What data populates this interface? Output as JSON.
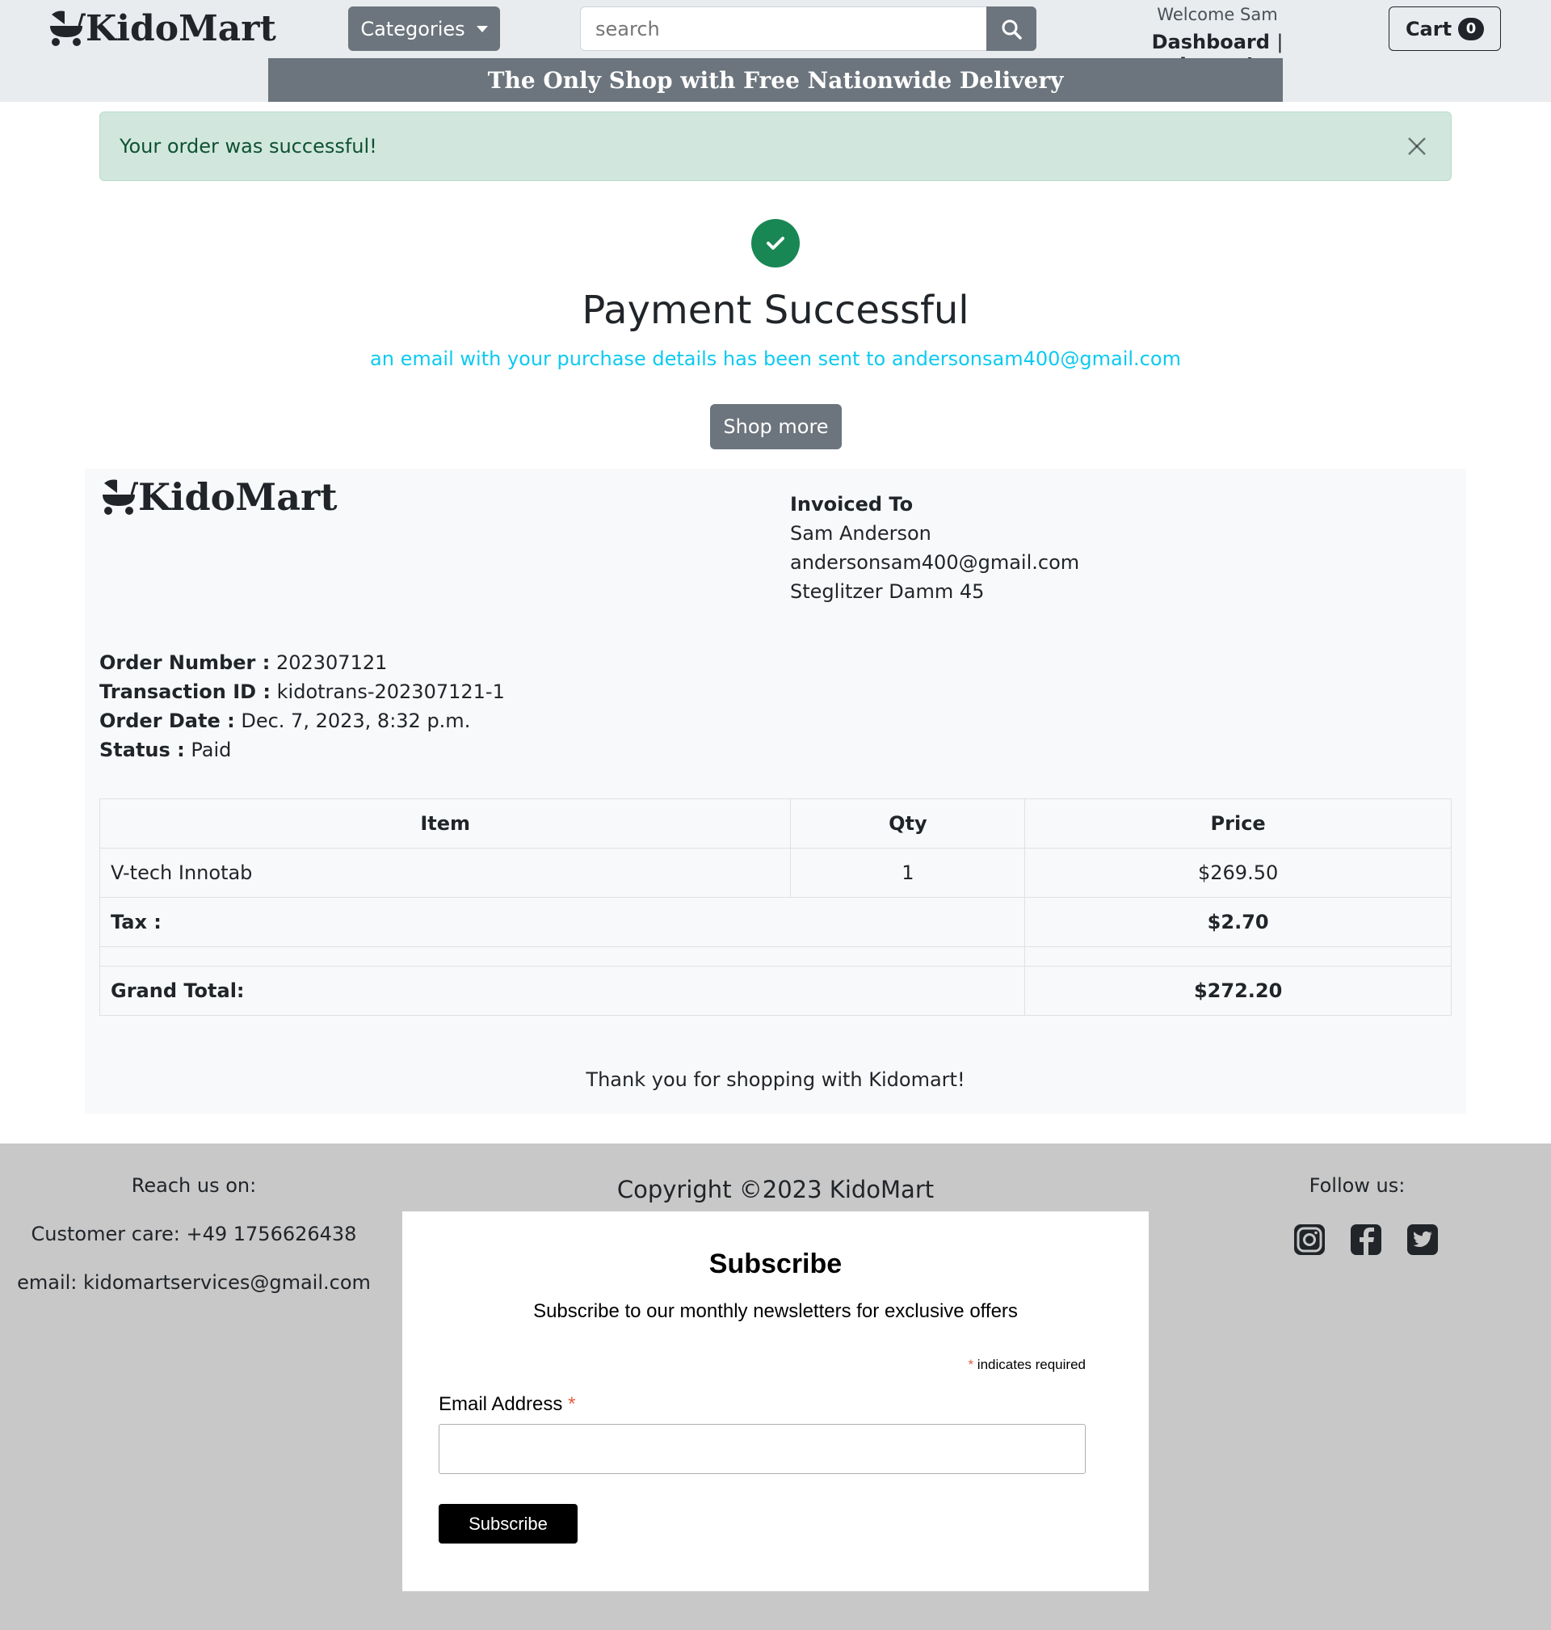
{
  "header": {
    "logo_text": "KidoMart",
    "categories_label": "Categories",
    "search": {
      "placeholder": "search",
      "value": ""
    },
    "welcome_text": "Welcome Sam",
    "dashboard_label": "Dashboard",
    "separator": "|",
    "logout_label": "Logout",
    "cart_label": "Cart",
    "cart_count": "0",
    "promo_text": "The Only Shop with Free Nationwide Delivery"
  },
  "alert": {
    "message": "Your order was successful!"
  },
  "success": {
    "title": "Payment Successful",
    "email_note": "an email with your purchase details has been sent to andersonsam400@gmail.com",
    "shop_more_label": "Shop more"
  },
  "invoice": {
    "logo_text": "KidoMart",
    "invoiced_to_label": "Invoiced To",
    "customer_name": "Sam Anderson",
    "customer_email": "andersonsam400@gmail.com",
    "customer_address": "Steglitzer Damm 45",
    "order_number_label": "Order Number :",
    "order_number": "202307121",
    "transaction_id_label": "Transaction ID :",
    "transaction_id": "kidotrans-202307121-1",
    "order_date_label": "Order Date :",
    "order_date": "Dec. 7, 2023, 8:32 p.m.",
    "status_label": "Status :",
    "status": "Paid",
    "table": {
      "headers": [
        "Item",
        "Qty",
        "Price"
      ],
      "rows": [
        {
          "item": "V-tech Innotab",
          "qty": "1",
          "price": "$269.50"
        }
      ],
      "tax_label": "Tax :",
      "tax_value": "$2.70",
      "grand_total_label": "Grand Total:",
      "grand_total_value": "$272.20"
    },
    "thanks": "Thank you for shopping with Kidomart!"
  },
  "footer": {
    "reach_label": "Reach us on:",
    "customer_care": "Customer care: +49 1756626438",
    "email_prefix": "email:",
    "email": "kidomartservices@gmail.com",
    "copyright": "Copyright ©2023 KidoMart",
    "follow_label": "Follow us:",
    "socials": [
      "instagram-icon",
      "facebook-icon",
      "twitter-icon"
    ],
    "subscribe": {
      "title": "Subscribe",
      "description": "Subscribe to our monthly newsletters for exclusive offers",
      "required_mark": "*",
      "required_note": "indicates required",
      "email_label": "Email Address",
      "email_value": "",
      "button_label": "Subscribe"
    }
  },
  "colors": {
    "header_bg": "#e9ecef",
    "secondary": "#6c757d",
    "alert_bg": "#d1e7dd",
    "alert_text": "#0f5132",
    "success_green": "#198754",
    "info_cyan": "#0dcaf0",
    "invoice_bg": "#f8f9fa",
    "footer_bg": "#c8c8c8",
    "required_red": "#e85c41"
  }
}
